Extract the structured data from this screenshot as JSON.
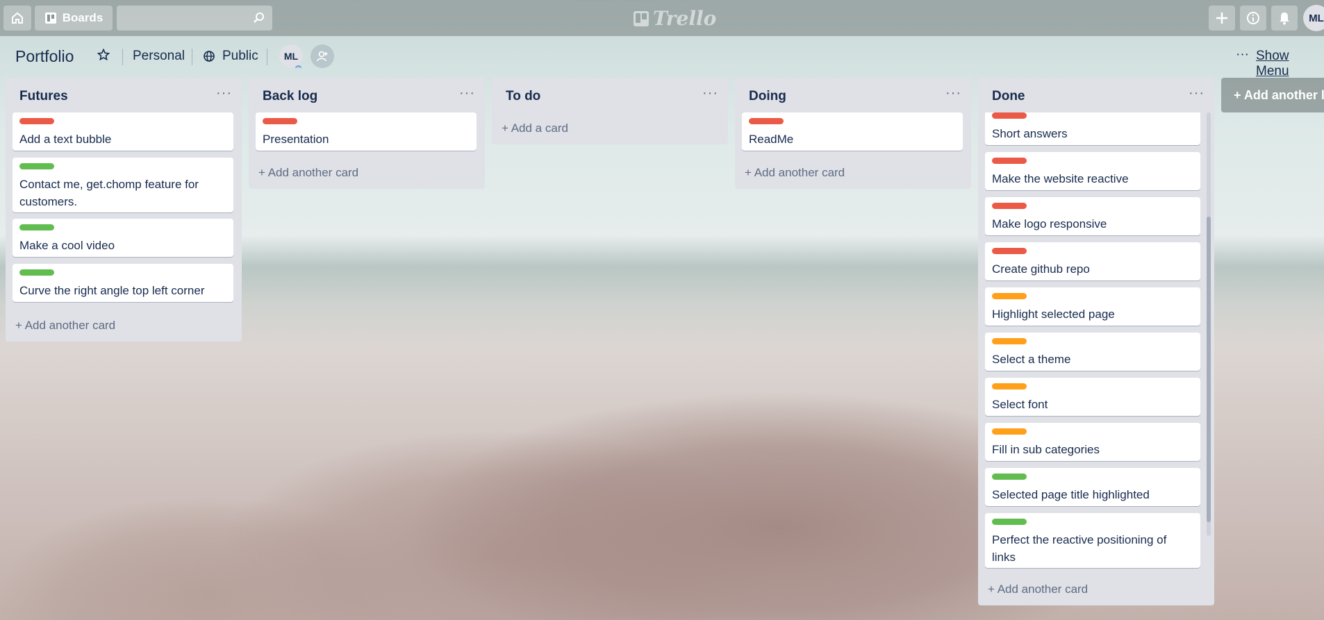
{
  "header": {
    "boards_label": "Boards",
    "search_value": "",
    "logo_text": "Trello",
    "avatar_initials": "ML"
  },
  "board": {
    "title": "Portfolio",
    "team_label": "Personal",
    "visibility_label": "Public",
    "member_initials": "ML",
    "show_menu_label": "Show Menu",
    "menu_dots": "···"
  },
  "lists": [
    {
      "title": "Futures",
      "cards": [
        {
          "label_color": "#eb5a46",
          "text": "Add a text bubble"
        },
        {
          "label_color": "#61bd4f",
          "text": "Contact me, get.chomp feature for customers."
        },
        {
          "label_color": "#61bd4f",
          "text": "Make a cool video"
        },
        {
          "label_color": "#61bd4f",
          "text": "Curve the right angle top left corner"
        }
      ],
      "add_label": "+ Add another card"
    },
    {
      "title": "Back log",
      "cards": [
        {
          "label_color": "#eb5a46",
          "text": "Presentation"
        }
      ],
      "add_label": "+ Add another card"
    },
    {
      "title": "To do",
      "cards": [],
      "add_label": "+ Add a card"
    },
    {
      "title": "Doing",
      "cards": [
        {
          "label_color": "#eb5a46",
          "text": "ReadMe"
        }
      ],
      "add_label": "+ Add another card"
    },
    {
      "title": "Done",
      "cards": [
        {
          "label_color": "#eb5a46",
          "text": "Short answers"
        },
        {
          "label_color": "#eb5a46",
          "text": "Make the website reactive"
        },
        {
          "label_color": "#eb5a46",
          "text": "Make logo responsive"
        },
        {
          "label_color": "#eb5a46",
          "text": "Create github repo"
        },
        {
          "label_color": "#ff9f1a",
          "text": "Highlight selected page"
        },
        {
          "label_color": "#ff9f1a",
          "text": "Select a theme"
        },
        {
          "label_color": "#ff9f1a",
          "text": "Select font"
        },
        {
          "label_color": "#ff9f1a",
          "text": "Fill in sub categories"
        },
        {
          "label_color": "#61bd4f",
          "text": "Selected page title highlighted"
        },
        {
          "label_color": "#61bd4f",
          "text": "Perfect the reactive positioning of links"
        }
      ],
      "add_label": "+ Add another card"
    }
  ],
  "add_list_label": "+ Add another list"
}
